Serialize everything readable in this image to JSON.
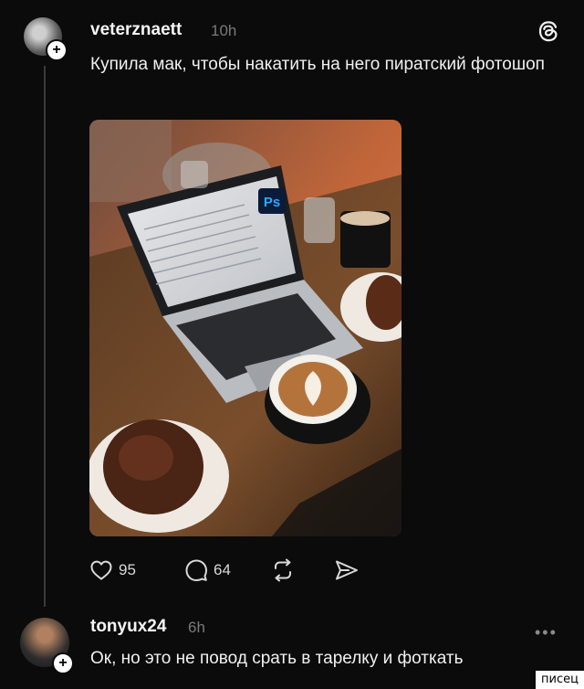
{
  "post": {
    "username": "veterznaett",
    "time": "10h",
    "text": "Купила мак, чтобы накатить на него пиратский фотошоп",
    "image_badge": "Ps",
    "actions": {
      "likes": "95",
      "comments": "64"
    }
  },
  "reply": {
    "username": "tonyux24",
    "time": "6h",
    "text": "Ок, но это не повод срать в тарелку и фоткать",
    "more": "•••"
  },
  "watermark": "писец",
  "icons": {
    "like": "heart-icon",
    "comment": "comment-icon",
    "repost": "repost-icon",
    "share": "send-icon",
    "app": "threads-icon",
    "follow": "plus-icon"
  }
}
